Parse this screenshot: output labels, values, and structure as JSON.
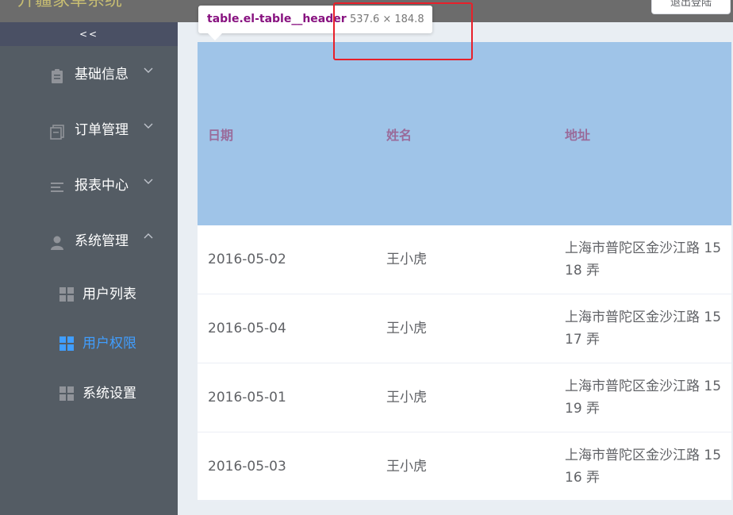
{
  "header": {
    "app_title": "升疆家卓系统",
    "logout_label": "退出登陆"
  },
  "sidebar": {
    "collapse_label": "<<",
    "menus": [
      {
        "label": "基础信息",
        "icon": "clipboard-icon",
        "expanded": false
      },
      {
        "label": "订单管理",
        "icon": "documents-icon",
        "expanded": false
      },
      {
        "label": "报表中心",
        "icon": "list-icon",
        "expanded": false
      },
      {
        "label": "系统管理",
        "icon": "user-icon",
        "expanded": true
      }
    ],
    "items": [
      {
        "label": "用户列表",
        "icon": "grid-icon",
        "active": false
      },
      {
        "label": "用户权限",
        "icon": "grid-icon",
        "active": true
      },
      {
        "label": "系统设置",
        "icon": "grid-icon",
        "active": false
      }
    ]
  },
  "devtools": {
    "selector": "table.el-table__header",
    "dimensions": "537.6 × 184.8"
  },
  "table": {
    "headers": [
      "日期",
      "姓名",
      "地址"
    ],
    "rows": [
      {
        "date": "2016-05-02",
        "name": "王小虎",
        "address": "上海市普陀区金沙江路 1518 弄"
      },
      {
        "date": "2016-05-04",
        "name": "王小虎",
        "address": "上海市普陀区金沙江路 1517 弄"
      },
      {
        "date": "2016-05-01",
        "name": "王小虎",
        "address": "上海市普陀区金沙江路 1519 弄"
      },
      {
        "date": "2016-05-03",
        "name": "王小虎",
        "address": "上海市普陀区金沙江路 1516 弄"
      }
    ]
  },
  "colors": {
    "sidebar_bg": "#545c64",
    "active": "#409eff",
    "header_bg": "#9fc4e8",
    "header_text": "#9a6b9a",
    "annotation": "#e8202a"
  }
}
